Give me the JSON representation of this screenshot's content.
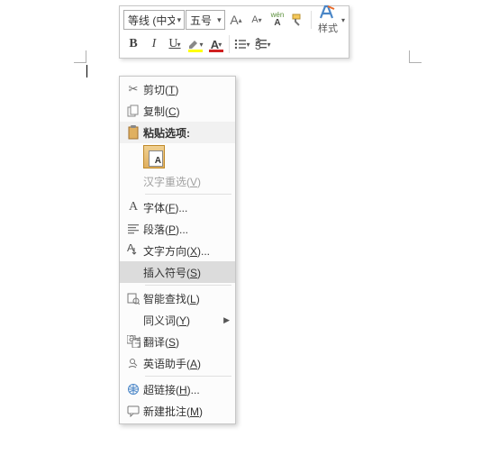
{
  "toolbar": {
    "font_name": "等线 (中文",
    "font_size": "五号",
    "styles_label": "样式"
  },
  "menu": {
    "cut": "剪切(T)",
    "copy": "复制(C)",
    "paste_options": "粘贴选项:",
    "cjk_reselect": "汉字重选(V)",
    "font": "字体(F)...",
    "paragraph": "段落(P)...",
    "text_direction": "文字方向(X)...",
    "insert_symbol": "插入符号(S)",
    "smart_lookup": "智能查找(L)",
    "synonyms": "同义词(Y)",
    "translate": "翻译(S)",
    "english_assistant": "英语助手(A)",
    "hyperlink": "超链接(H)...",
    "new_comment": "新建批注(M)"
  }
}
